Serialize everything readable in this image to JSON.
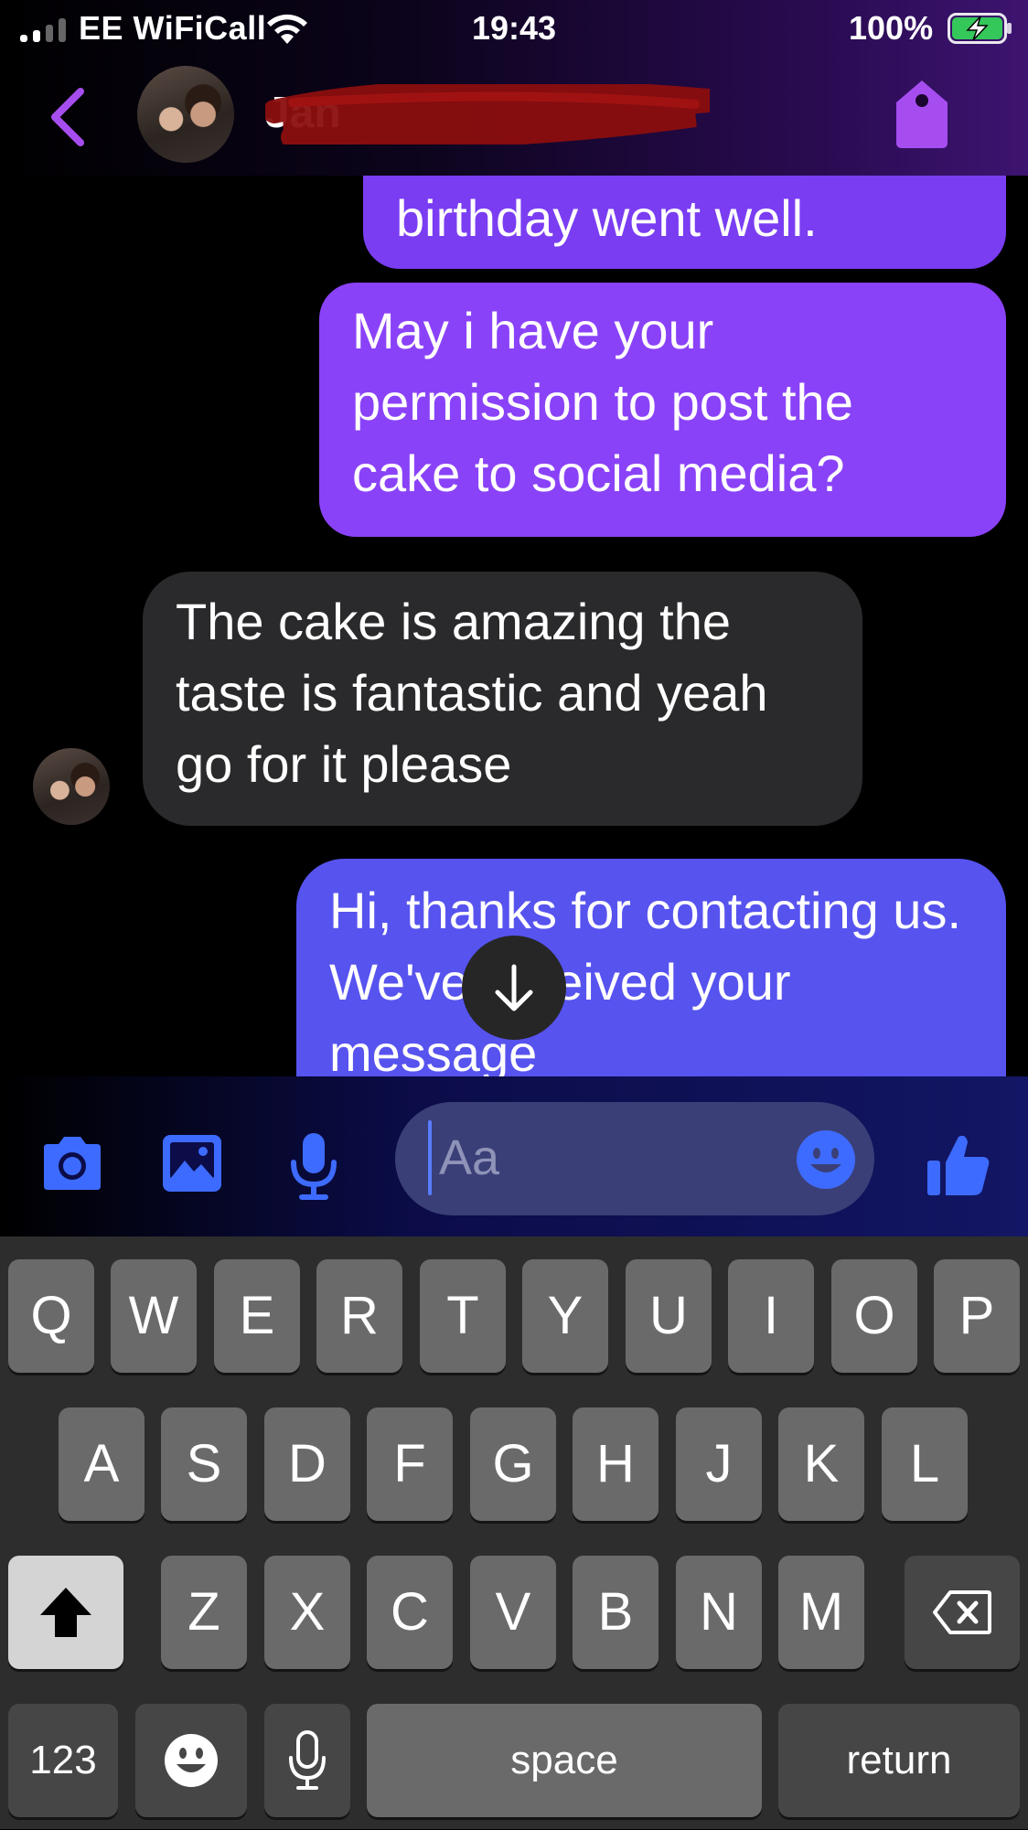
{
  "status_bar": {
    "carrier": "EE WiFiCall",
    "time": "19:43",
    "battery_percent": "100%",
    "battery_level": 1.0,
    "charging": true,
    "signal_bars": 2,
    "battery_color": "#34c759"
  },
  "header": {
    "contact_name": "Jan",
    "name_redacted": true,
    "accent_color": "#a64df0",
    "back_icon": "chevron-left-icon",
    "avatar_icon": "contact-avatar",
    "tag_icon": "tag-icon"
  },
  "messages": [
    {
      "direction": "outgoing",
      "text": "birthday went well.",
      "color": "#7a3df2"
    },
    {
      "direction": "outgoing",
      "text": "May i have your permission to post the cake to social media?",
      "color": "#8a42f8"
    },
    {
      "direction": "incoming",
      "text": "The cake is amazing the taste  is fantastic and yeah go for it please",
      "color": "#2a2a2c"
    },
    {
      "direction": "outgoing",
      "text": "Hi, thanks for contacting us. We've received your message",
      "color": "#5753ef"
    }
  ],
  "scroll_down_icon": "arrow-down-icon",
  "composer": {
    "placeholder": "Aa",
    "accent_color": "#3d6bff",
    "icons": [
      "camera-icon",
      "photo-icon",
      "microphone-icon",
      "emoji-icon",
      "thumbs-up-icon"
    ]
  },
  "keyboard": {
    "row1": [
      "Q",
      "W",
      "E",
      "R",
      "T",
      "Y",
      "U",
      "I",
      "O",
      "P"
    ],
    "row2": [
      "A",
      "S",
      "D",
      "F",
      "G",
      "H",
      "J",
      "K",
      "L"
    ],
    "row3": [
      "Z",
      "X",
      "C",
      "V",
      "B",
      "N",
      "M"
    ],
    "numbers_label": "123",
    "space_label": "space",
    "return_label": "return",
    "shift_icon": "shift-icon",
    "delete_icon": "backspace-icon",
    "emoji_key_icon": "emoji-icon",
    "dictation_icon": "microphone-icon"
  }
}
